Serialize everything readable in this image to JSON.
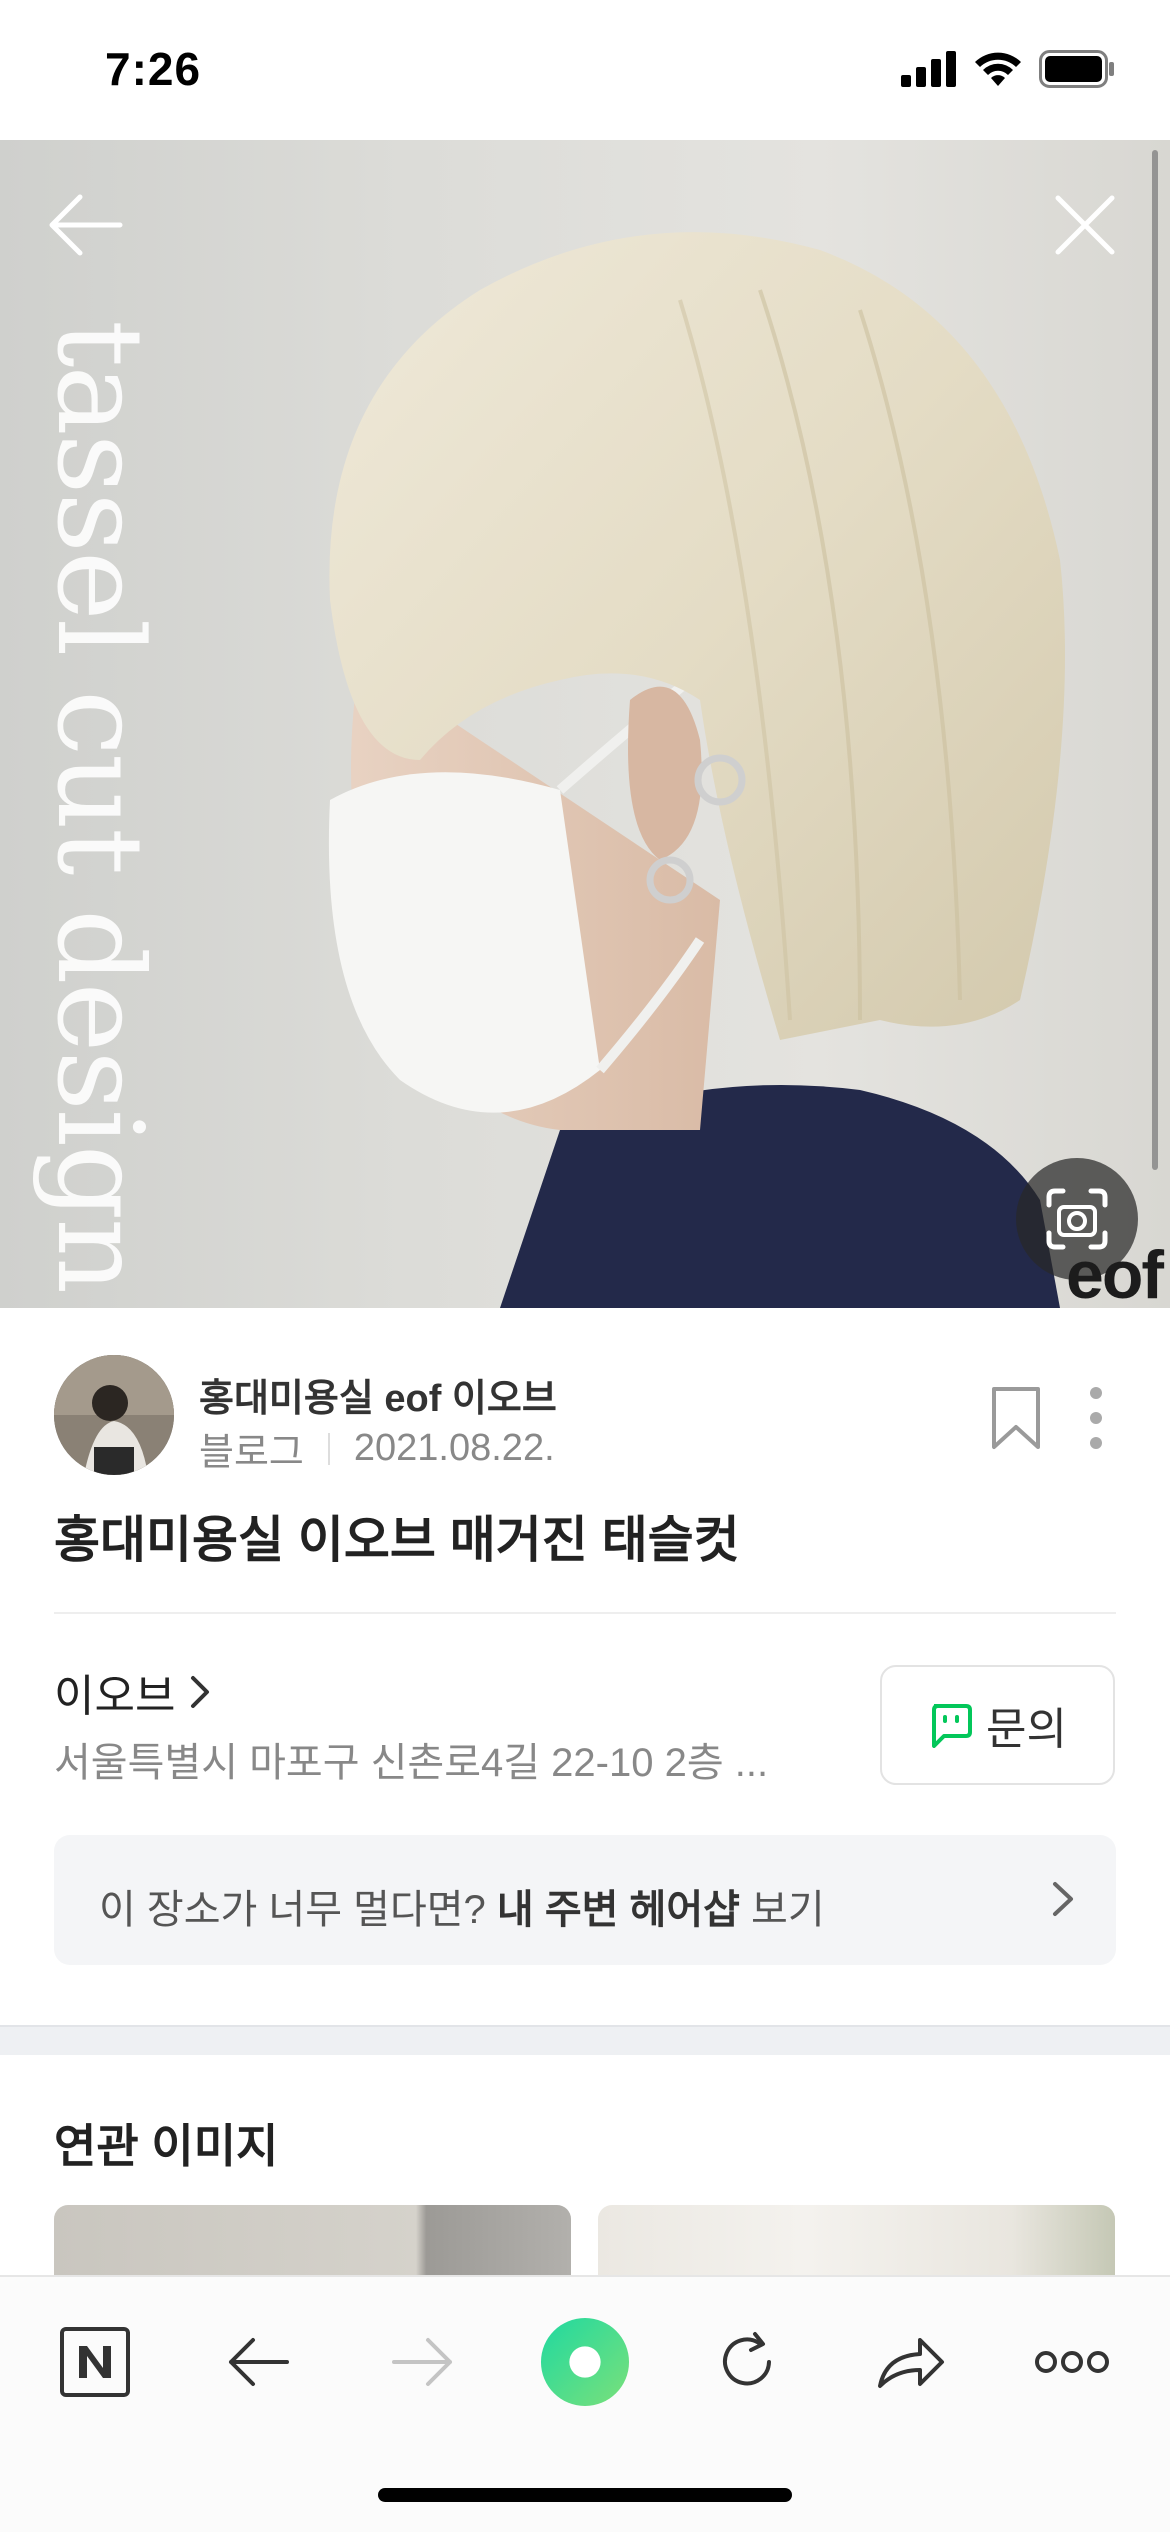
{
  "status_bar": {
    "time": "7:26",
    "icons": [
      "cellular-signal-icon",
      "wifi-icon",
      "battery-icon"
    ]
  },
  "hero": {
    "overlay_text": "tassel cut design",
    "watermark": "eof",
    "icons": [
      "back-arrow-icon",
      "close-icon",
      "lens-search-icon"
    ]
  },
  "post": {
    "author": "홍대미용실 eof 이오브",
    "source": "블로그",
    "date": "2021.08.22.",
    "title": "홍대미용실 이오브 매거진 태슬컷"
  },
  "place": {
    "name": "이오브",
    "address": "서울특별시 마포구 신촌로4길 22-10 2층 ...",
    "inquiry_label": "문의"
  },
  "nearby": {
    "prefix": "이 장소가 너무 멀다면? ",
    "bold": "내 주변 헤어샵",
    "suffix": " 보기"
  },
  "related": {
    "title": "연관 이미지"
  },
  "toolbar": {
    "items": [
      "naver-home-icon",
      "back-icon",
      "forward-icon",
      "green-dot-icon",
      "refresh-icon",
      "share-icon",
      "more-icon"
    ]
  },
  "colors": {
    "accent_green": "#03c75a",
    "text_primary": "#222222",
    "text_secondary": "#888888",
    "banner_bg": "#f4f5f7"
  }
}
